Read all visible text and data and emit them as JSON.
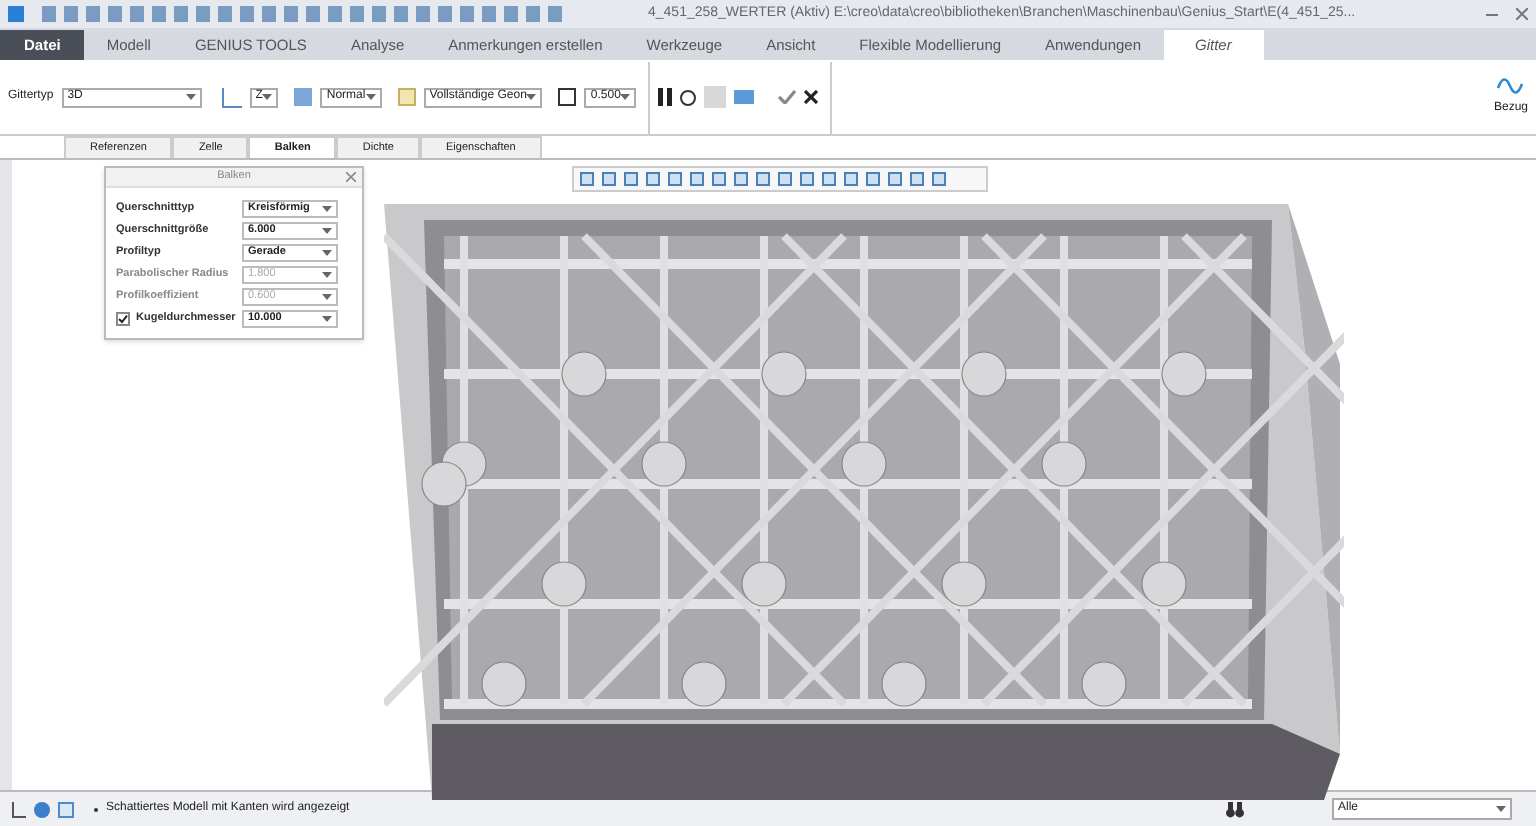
{
  "window": {
    "title": "4_451_258_WERTER (Aktiv) E:\\creo\\data\\creo\\bibliotheken\\Branchen\\Maschinenbau\\Genius_Start\\E(4_451_25..."
  },
  "tabs": [
    {
      "label": "Datei",
      "selected": false,
      "kind": "file"
    },
    {
      "label": "Modell",
      "selected": false
    },
    {
      "label": "GENIUS TOOLS",
      "selected": false
    },
    {
      "label": "Analyse",
      "selected": false
    },
    {
      "label": "Anmerkungen erstellen",
      "selected": false
    },
    {
      "label": "Werkzeuge",
      "selected": false
    },
    {
      "label": "Ansicht",
      "selected": false
    },
    {
      "label": "Flexible Modellierung",
      "selected": false
    },
    {
      "label": "Anwendungen",
      "selected": false
    },
    {
      "label": "Gitter",
      "selected": true
    }
  ],
  "ribbon": {
    "lattice_type_label": "Gittertyp",
    "lattice_type": "3D",
    "axis": "Z",
    "mode": "Normal",
    "geometry": "Vollständige Geon",
    "scale": "0.500",
    "datum_label": "Bezug"
  },
  "subtabs": [
    {
      "label": "Referenzen",
      "selected": false
    },
    {
      "label": "Zelle",
      "selected": false
    },
    {
      "label": "Balken",
      "selected": true
    },
    {
      "label": "Dichte",
      "selected": false
    },
    {
      "label": "Eigenschaften",
      "selected": false
    }
  ],
  "panel": {
    "title": "Balken",
    "rows": [
      {
        "label": "Querschnitttyp",
        "value": "Kreisförmig",
        "disabled": false
      },
      {
        "label": "Querschnittgröße",
        "value": "6.000",
        "disabled": false
      },
      {
        "label": "Profiltyp",
        "value": "Gerade",
        "disabled": false
      },
      {
        "label": "Parabolischer Radius",
        "value": "1.800",
        "disabled": true
      },
      {
        "label": "Profilkoeffizient",
        "value": "0.600",
        "disabled": true
      },
      {
        "label": "Kugeldurchmesser",
        "value": "10.000",
        "disabled": false,
        "kind": "checkbox",
        "checked": true
      }
    ]
  },
  "status_bar": {
    "message": "Schattiertes Modell mit Kanten wird angezeigt",
    "filter": "Alle"
  }
}
